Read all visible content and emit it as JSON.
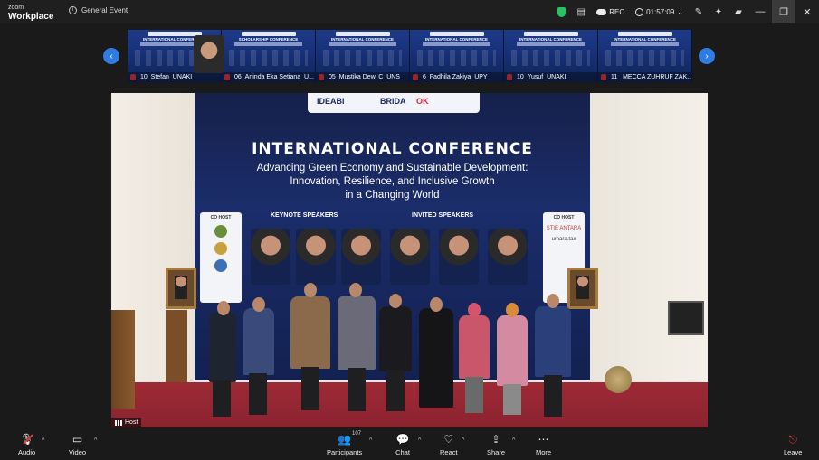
{
  "app": {
    "brand_line1": "zoom",
    "brand_line2": "Workplace",
    "meeting_title": "General Event"
  },
  "status": {
    "rec_label": "REC",
    "timer": "01:57:09"
  },
  "participants_strip": [
    {
      "name": "10_Stefan_UNAKI",
      "conference": "INTERNATIONAL CONFERENCE"
    },
    {
      "name": "06_Aninda Eka Setiana_U...",
      "conference": "SCHOLARSHIP CONFERENCE"
    },
    {
      "name": "05_Mustika Dewi C_UNS",
      "conference": "INTERNATIONAL CONFERENCE"
    },
    {
      "name": "6_Fadhila Zakiya_UPY",
      "conference": "INTERNATIONAL CONFERENCE"
    },
    {
      "name": "10_Yusuf_UNAKI",
      "conference": "INTERNATIONAL CONFERENCE"
    },
    {
      "name": "11_ MECCA ZUHRUF ZAK...",
      "conference": "INTERNATIONAL CONFERENCE"
    }
  ],
  "main_video": {
    "logo_1": "IDEABI",
    "logo_2": "BRIDA",
    "logo_3": "OK",
    "banner_title": "INTERNATIONAL CONFERENCE",
    "banner_subtitle_1": "Advancing Green Economy and Sustainable Development:",
    "banner_subtitle_2": "Innovation, Resilience, and Inclusive Growth",
    "banner_subtitle_3": "in a Changing World",
    "keynote_heading": "KEYNOTE SPEAKERS",
    "invited_heading": "INVITED SPEAKERS",
    "cohost_left": "CO HOST",
    "cohost_right": "CO HOST",
    "cohost_right_logo_1": "STIE ANTARA",
    "cohost_right_logo_2": "umara.tax",
    "host_label": "Host"
  },
  "toolbar": {
    "audio": "Audio",
    "video": "Video",
    "participants": "Participants",
    "participants_count": "107",
    "chat": "Chat",
    "react": "React",
    "share": "Share",
    "more": "More",
    "leave": "Leave"
  },
  "colors": {
    "accent_blue": "#2f7de1",
    "shield_green": "#22c55e",
    "muted_red": "#e23b3b",
    "banner_navy": "#1b2d6b"
  }
}
